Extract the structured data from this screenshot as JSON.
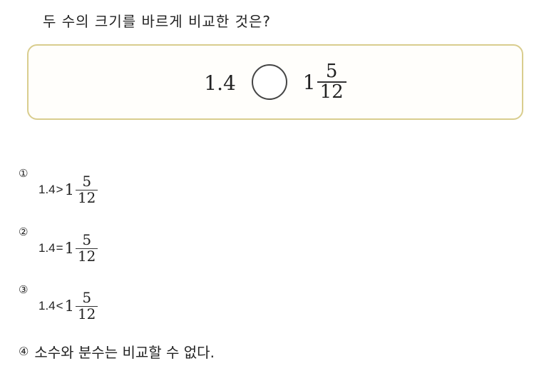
{
  "question": "두 수의 크기를 바르게 비교한 것은?",
  "box": {
    "left_value": "1.4",
    "whole": "1",
    "numerator": "5",
    "denominator": "12"
  },
  "choices": [
    {
      "number": "①",
      "decimal": "1.4",
      "operator": ">",
      "whole": "1",
      "numerator": "5",
      "denominator": "12"
    },
    {
      "number": "②",
      "decimal": "1.4",
      "operator": "=",
      "whole": "1",
      "numerator": "5",
      "denominator": "12"
    },
    {
      "number": "③",
      "decimal": "1.4",
      "operator": "<",
      "whole": "1",
      "numerator": "5",
      "denominator": "12"
    },
    {
      "number": "④",
      "text": "소수와 분수는 비교할 수 없다."
    }
  ]
}
